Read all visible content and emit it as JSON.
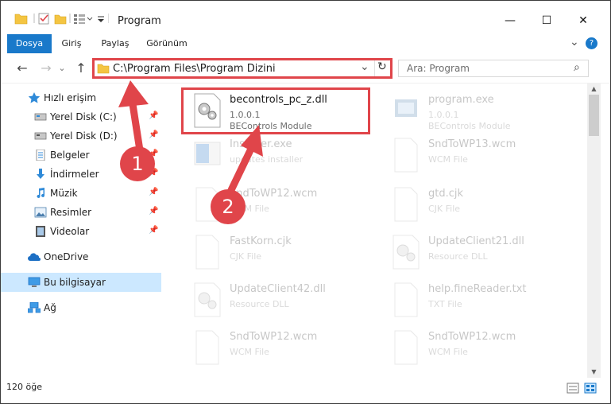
{
  "window": {
    "title": "Program",
    "minimize": "—",
    "maximize": "☐",
    "close": "✕"
  },
  "ribbon": {
    "tabs": [
      {
        "label": "Dosya",
        "active": true
      },
      {
        "label": "Giriş"
      },
      {
        "label": "Paylaş"
      },
      {
        "label": "Görünüm"
      }
    ],
    "expand_chevron": "⌄",
    "help": "?"
  },
  "address": {
    "path": "C:\\Program Files\\Program Dizini",
    "dropdown": "⌄",
    "refresh": "↻"
  },
  "search": {
    "placeholder": "Ara: Program",
    "icon": "⌕"
  },
  "nav": {
    "back": "←",
    "forward": "→",
    "recent": "⌄",
    "up": "↑"
  },
  "sidebar": {
    "items": [
      {
        "label": "Hızlı erişim",
        "icon": "star-icon"
      },
      {
        "label": "Yerel Disk (C:)",
        "icon": "drive-icon",
        "pinned": true
      },
      {
        "label": "Yerel Disk (D:)",
        "icon": "drive-icon",
        "pinned": true
      },
      {
        "label": "Belgeler",
        "icon": "documents-icon",
        "pinned": true
      },
      {
        "label": "İndirmeler",
        "icon": "download-icon",
        "pinned": true
      },
      {
        "label": "Müzik",
        "icon": "music-icon",
        "pinned": true
      },
      {
        "label": "Resimler",
        "icon": "pictures-icon",
        "pinned": true
      },
      {
        "label": "Videolar",
        "icon": "video-icon",
        "pinned": true
      },
      {
        "label": "OneDrive",
        "icon": "cloud-icon"
      },
      {
        "label": "Bu bilgisayar",
        "icon": "computer-icon",
        "selected": true
      },
      {
        "label": "Ağ",
        "icon": "network-icon"
      }
    ],
    "pin_glyph": "📌"
  },
  "files": [
    {
      "name": "becontrols_pc_z.dll",
      "line2": "1.0.0.1",
      "line3": "BEControls Module",
      "icon": "dll-icon",
      "highlight": true
    },
    {
      "name": "program.exe",
      "line2": "1.0.0.1",
      "line3": "BEControls Module",
      "icon": "exe-icon"
    },
    {
      "name": "Installer.exe",
      "line2": "",
      "line3": "updates installer",
      "icon": "installer-icon"
    },
    {
      "name": "SndToWP13.wcm",
      "line2": "",
      "line3": "WCM File",
      "icon": "file-icon"
    },
    {
      "name": "SndToWP12.wcm",
      "line2": "",
      "line3": "WCM File",
      "icon": "file-icon"
    },
    {
      "name": "gtd.cjk",
      "line2": "",
      "line3": "CJK File",
      "icon": "file-icon"
    },
    {
      "name": "FastKorn.cjk",
      "line2": "",
      "line3": "CJK File",
      "icon": "file-icon"
    },
    {
      "name": "UpdateClient21.dll",
      "line2": "",
      "line3": "Resource DLL",
      "icon": "dll-icon"
    },
    {
      "name": "UpdateClient42.dll",
      "line2": "",
      "line3": "Resource DLL",
      "icon": "dll-icon"
    },
    {
      "name": "help.fineReader.txt",
      "line2": "",
      "line3": "TXT File",
      "icon": "file-icon"
    },
    {
      "name": "SndToWP12.wcm",
      "line2": "",
      "line3": "WCM File",
      "icon": "file-icon"
    },
    {
      "name": "SndToWP12.wcm",
      "line2": "",
      "line3": "WCM File",
      "icon": "file-icon"
    }
  ],
  "status": {
    "count": "120 öğe"
  },
  "annotations": {
    "badge1": "1",
    "badge2": "2",
    "color": "#e0454a"
  },
  "colors": {
    "accent": "#1979ca",
    "selection": "#cce8ff",
    "annotation": "#e0454a"
  }
}
